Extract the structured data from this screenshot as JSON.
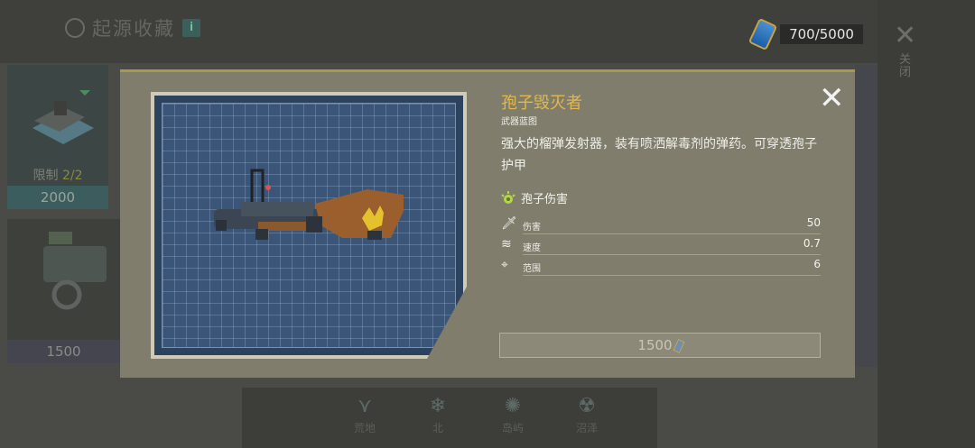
{
  "header": {
    "title": "起源收藏",
    "info_label": "i"
  },
  "currency": {
    "value": "700/5000",
    "icon": "canister-icon"
  },
  "background": {
    "close_icon": "close-icon",
    "close_text": "关闭",
    "card1": {
      "limit_label": "限制",
      "limit_value": "2/2",
      "price": "2000"
    },
    "card2": {
      "price": "1500"
    },
    "regions": [
      {
        "label": "荒地",
        "icon": "grass-icon"
      },
      {
        "label": "北",
        "icon": "snowflake-icon"
      },
      {
        "label": "岛屿",
        "icon": "island-icon"
      },
      {
        "label": "沼泽",
        "icon": "radiation-icon"
      }
    ]
  },
  "modal": {
    "name": "孢子毁灭者",
    "subtitle": "武器蓝图",
    "description": "强大的榴弹发射器，装有喷洒解毒剂的弹药。可穿透孢子护甲",
    "effect": {
      "label": "孢子伤害",
      "icon": "spore-icon"
    },
    "stats": [
      {
        "label": "伤害",
        "value": "50",
        "icon": "knife-icon"
      },
      {
        "label": "速度",
        "value": "0.7",
        "icon": "speed-icon"
      },
      {
        "label": "范围",
        "value": "6",
        "icon": "crosshair-icon"
      }
    ],
    "buy": {
      "price": "1500",
      "icon": "canister-icon"
    },
    "close_icon": "close-icon",
    "colors": {
      "title": "#e2b94a",
      "blueprint": "#3a5577"
    }
  }
}
